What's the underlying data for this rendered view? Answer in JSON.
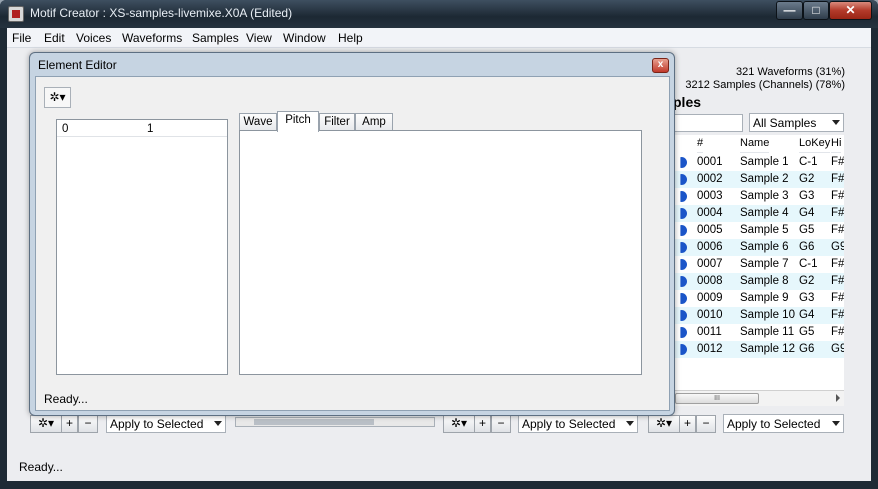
{
  "window": {
    "title": "Motif Creator : XS-samples-livemixe.X0A (Edited)",
    "minimize": "—",
    "maximize": "□",
    "close": "✕"
  },
  "menu": [
    "File",
    "Edit",
    "Voices",
    "Waveforms",
    "Samples",
    "View",
    "Window",
    "Help"
  ],
  "stats": {
    "waveforms": "321 Waveforms (31%)",
    "samples": "3212 Samples (Channels) (78%)"
  },
  "samples_panel": {
    "title_partial": "ples",
    "filter_value": "All Samples",
    "columns": [
      "#",
      "Name",
      "LoKey",
      "Hi"
    ],
    "rows": [
      {
        "num": "0001",
        "name": "Sample 1",
        "lokey": "C-1",
        "hi": "F#"
      },
      {
        "num": "0002",
        "name": "Sample 2",
        "lokey": "G2",
        "hi": "F#"
      },
      {
        "num": "0003",
        "name": "Sample 3",
        "lokey": "G3",
        "hi": "F#"
      },
      {
        "num": "0004",
        "name": "Sample 4",
        "lokey": "G4",
        "hi": "F#"
      },
      {
        "num": "0005",
        "name": "Sample 5",
        "lokey": "G5",
        "hi": "F#"
      },
      {
        "num": "0006",
        "name": "Sample 6",
        "lokey": "G6",
        "hi": "G9"
      },
      {
        "num": "0007",
        "name": "Sample 7",
        "lokey": "C-1",
        "hi": "F#"
      },
      {
        "num": "0008",
        "name": "Sample 8",
        "lokey": "G2",
        "hi": "F#"
      },
      {
        "num": "0009",
        "name": "Sample 9",
        "lokey": "G3",
        "hi": "F#"
      },
      {
        "num": "0010",
        "name": "Sample 10",
        "lokey": "G4",
        "hi": "F#"
      },
      {
        "num": "0011",
        "name": "Sample 11",
        "lokey": "G5",
        "hi": "F#"
      },
      {
        "num": "0012",
        "name": "Sample 12",
        "lokey": "G6",
        "hi": "G9"
      }
    ],
    "scroll_thumb": "III",
    "scroll_right": "▸"
  },
  "toolbars": {
    "gear": "✲▾",
    "add": "+",
    "remove": "−",
    "apply_label": "Apply to Selected"
  },
  "status_main": "Ready...",
  "element_editor": {
    "title": "Element Editor",
    "close": "x",
    "gear": "✲▾",
    "list_columns": [
      "0",
      "1"
    ],
    "tabs": [
      "Wave",
      "Pitch",
      "Filter",
      "Amp"
    ],
    "active_tab": "Pitch",
    "status": "Ready..."
  }
}
